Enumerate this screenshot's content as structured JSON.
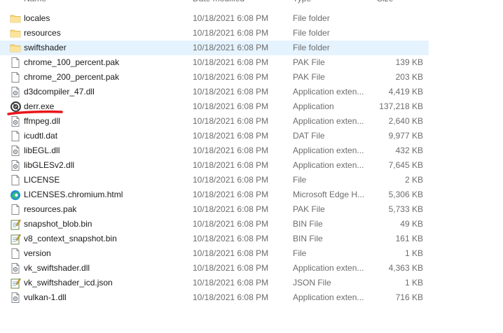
{
  "header": {
    "name": "Name",
    "date": "Date modified",
    "type": "Type",
    "size": "Size"
  },
  "selected_index": 2,
  "files": [
    {
      "name": "locales",
      "date": "10/18/2021 6:08 PM",
      "type": "File folder",
      "size": "",
      "icon": "folder-icon"
    },
    {
      "name": "resources",
      "date": "10/18/2021 6:08 PM",
      "type": "File folder",
      "size": "",
      "icon": "folder-icon"
    },
    {
      "name": "swiftshader",
      "date": "10/18/2021 6:08 PM",
      "type": "File folder",
      "size": "",
      "icon": "folder-icon"
    },
    {
      "name": "chrome_100_percent.pak",
      "date": "10/18/2021 6:08 PM",
      "type": "PAK File",
      "size": "139 KB",
      "icon": "file-icon"
    },
    {
      "name": "chrome_200_percent.pak",
      "date": "10/18/2021 6:08 PM",
      "type": "PAK File",
      "size": "203 KB",
      "icon": "file-icon"
    },
    {
      "name": "d3dcompiler_47.dll",
      "date": "10/18/2021 6:08 PM",
      "type": "Application exten...",
      "size": "4,419 KB",
      "icon": "dll-icon"
    },
    {
      "name": "derr.exe",
      "date": "10/18/2021 6:08 PM",
      "type": "Application",
      "size": "137,218 KB",
      "icon": "app-icon"
    },
    {
      "name": "ffmpeg.dll",
      "date": "10/18/2021 6:08 PM",
      "type": "Application exten...",
      "size": "2,640 KB",
      "icon": "dll-icon"
    },
    {
      "name": "icudtl.dat",
      "date": "10/18/2021 6:08 PM",
      "type": "DAT File",
      "size": "9,977 KB",
      "icon": "file-icon"
    },
    {
      "name": "libEGL.dll",
      "date": "10/18/2021 6:08 PM",
      "type": "Application exten...",
      "size": "432 KB",
      "icon": "dll-icon"
    },
    {
      "name": "libGLESv2.dll",
      "date": "10/18/2021 6:08 PM",
      "type": "Application exten...",
      "size": "7,645 KB",
      "icon": "dll-icon"
    },
    {
      "name": "LICENSE",
      "date": "10/18/2021 6:08 PM",
      "type": "File",
      "size": "2 KB",
      "icon": "file-icon"
    },
    {
      "name": "LICENSES.chromium.html",
      "date": "10/18/2021 6:08 PM",
      "type": "Microsoft Edge H...",
      "size": "5,306 KB",
      "icon": "edge-icon"
    },
    {
      "name": "resources.pak",
      "date": "10/18/2021 6:08 PM",
      "type": "PAK File",
      "size": "5,733 KB",
      "icon": "file-icon"
    },
    {
      "name": "snapshot_blob.bin",
      "date": "10/18/2021 6:08 PM",
      "type": "BIN File",
      "size": "49 KB",
      "icon": "notepad-icon"
    },
    {
      "name": "v8_context_snapshot.bin",
      "date": "10/18/2021 6:08 PM",
      "type": "BIN File",
      "size": "161 KB",
      "icon": "notepad-icon"
    },
    {
      "name": "version",
      "date": "10/18/2021 6:08 PM",
      "type": "File",
      "size": "1 KB",
      "icon": "file-icon"
    },
    {
      "name": "vk_swiftshader.dll",
      "date": "10/18/2021 6:08 PM",
      "type": "Application exten...",
      "size": "4,363 KB",
      "icon": "dll-icon"
    },
    {
      "name": "vk_swiftshader_icd.json",
      "date": "10/18/2021 6:08 PM",
      "type": "JSON File",
      "size": "1 KB",
      "icon": "notepad-icon"
    },
    {
      "name": "vulkan-1.dll",
      "date": "10/18/2021 6:08 PM",
      "type": "Application exten...",
      "size": "716 KB",
      "icon": "dll-icon"
    }
  ],
  "colors": {
    "selection": "#e5f3ff",
    "folder": "#f8d775",
    "annotation": "#e8161b"
  }
}
